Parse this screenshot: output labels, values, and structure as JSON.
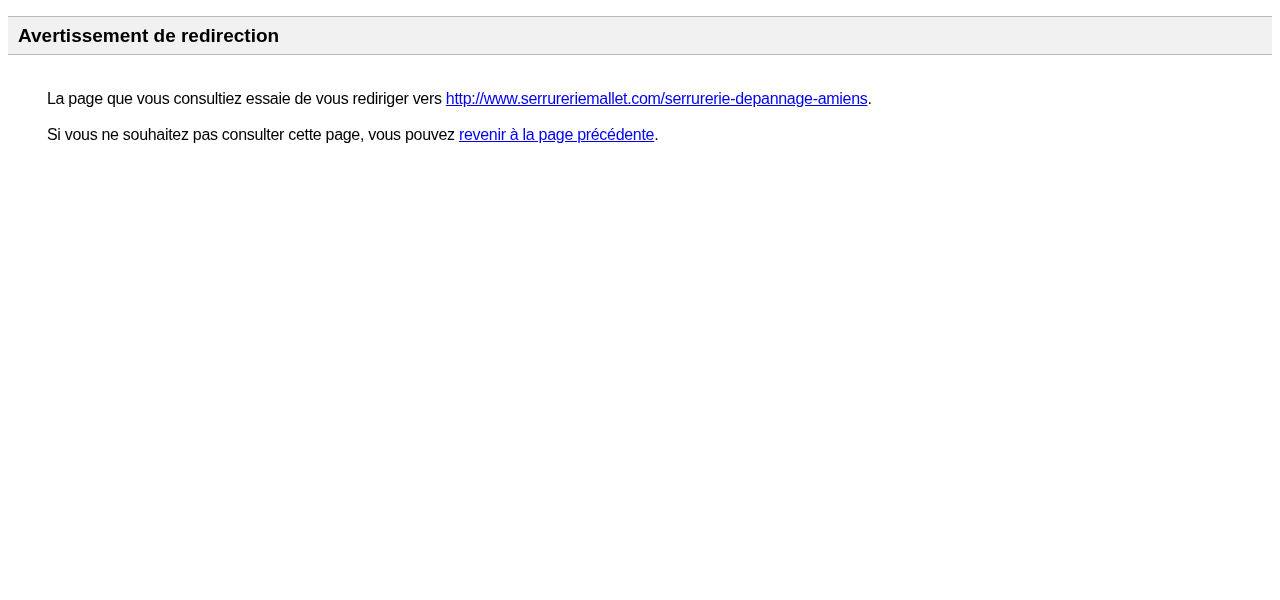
{
  "header": {
    "title": "Avertissement de redirection"
  },
  "paragraphs": [
    {
      "before": "La page que vous consultiez essaie de vous rediriger vers ",
      "link": "http://www.serrureriemallet.com/serrurerie-depannage-amiens",
      "after": "."
    },
    {
      "before": "Si vous ne souhaitez pas consulter cette page, vous pouvez ",
      "link": "revenir à la page précédente",
      "after": "."
    }
  ]
}
